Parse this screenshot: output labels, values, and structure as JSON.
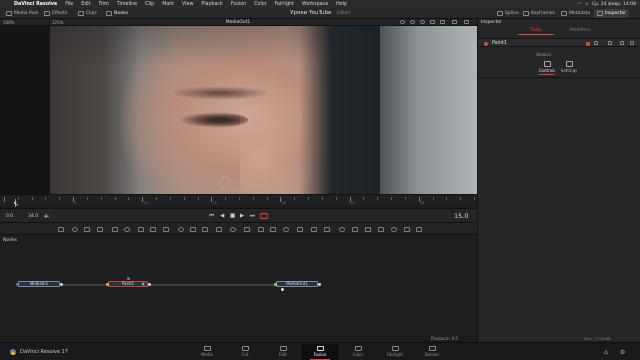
{
  "menubar": {
    "apple": "",
    "items": [
      "DaVinci Resolve",
      "File",
      "Edit",
      "Trim",
      "Timeline",
      "Clip",
      "Mark",
      "View",
      "Playback",
      "Fusion",
      "Color",
      "Fairlight",
      "Workspace",
      "Help"
    ],
    "clock": "Ср, 24 февр. 14:08"
  },
  "toolbar": {
    "left": [
      "Media Pool",
      "Effects",
      "Clips",
      "Nodes"
    ],
    "project_title": "Уроки YouTube",
    "project_status": "Edited",
    "right": [
      "Spline",
      "Keyframes",
      "Metadata",
      "Inspector"
    ]
  },
  "viewer": {
    "zoom": "100%",
    "zoom2": "125%",
    "title": "MediaOut1"
  },
  "transport": {
    "tc_in": "0.0",
    "tc_out": "34.0",
    "current_frame": "15.0"
  },
  "ruler": {
    "labels": [
      "5",
      "10",
      "15",
      "20",
      "25",
      "30"
    ]
  },
  "nodes": {
    "title": "Nodes",
    "node_names": [
      "MediaIn1",
      "Paint1",
      "MediaOut1"
    ]
  },
  "status": {
    "playback": "Playback: 9.2 frames/sec",
    "gpu": "63% - 3718 MB"
  },
  "inspector": {
    "title": "Inspector",
    "tab_tools": "Tools",
    "tab_modifiers": "Modifiers",
    "node_name": "Paint1",
    "stroke_label": "Stroke1",
    "sub_tabs": [
      "Controls",
      "Settings"
    ]
  },
  "pagebar": {
    "app_name": "DaVinci Resolve 17",
    "pages": [
      "Media",
      "Cut",
      "Edit",
      "Fusion",
      "Color",
      "Fairlight",
      "Deliver"
    ],
    "active_page": "Fusion"
  },
  "colors": {
    "accent": "#e0433a",
    "node_border": "#6d8ab0",
    "paint_node": "#b44a46"
  }
}
